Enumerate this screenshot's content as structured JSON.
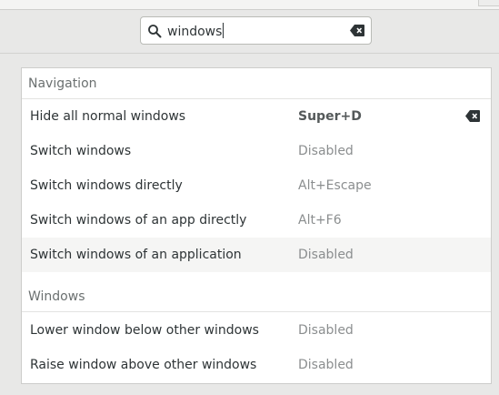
{
  "search": {
    "query": "windows",
    "icon": "search-icon",
    "clear_icon": "clear-icon"
  },
  "sections": [
    {
      "title": "Navigation",
      "rows": [
        {
          "name": "Hide all normal windows",
          "accel": "Super+D"
        },
        {
          "name": "Switch windows",
          "accel": "Disabled"
        },
        {
          "name": "Switch windows directly",
          "accel": "Alt+Escape"
        },
        {
          "name": "Switch windows of an app directly",
          "accel": "Alt+F6"
        },
        {
          "name": "Switch windows of an application",
          "accel": "Disabled"
        }
      ]
    },
    {
      "title": "Windows",
      "rows": [
        {
          "name": "Lower window below other windows",
          "accel": "Disabled"
        },
        {
          "name": "Raise window above other windows",
          "accel": "Disabled"
        }
      ]
    }
  ],
  "colors": {
    "background": "#e8e8e7",
    "list_background": "#ffffff",
    "row_highlight": "#f5f5f4",
    "text": "#2e3436",
    "muted": "#8b8e8f"
  }
}
